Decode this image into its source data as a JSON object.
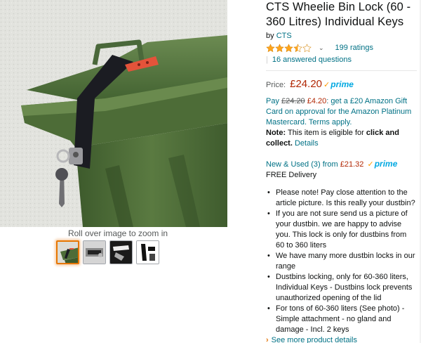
{
  "product": {
    "title": "CTS Wheelie Bin Lock (60 - 360 Litres) Individual Keys",
    "by_label": "by",
    "brand": "CTS",
    "rating": 3.5,
    "ratings_count": "199 ratings",
    "answered_questions": "16 answered questions",
    "qa_separator": "|"
  },
  "image": {
    "zoom_hint": "Roll over image to zoom in",
    "thumbnail_count": 4,
    "selected_thumbnail": 0
  },
  "price": {
    "label": "Price:",
    "value": "£24.20",
    "prime_label": "prime"
  },
  "promo": {
    "pay": "Pay",
    "old_price": "£24.20",
    "new_price": "£4.20",
    "text": ": get a £20 Amazon Gift Card on approval for the Amazon Platinum Mastercard. Terms apply."
  },
  "note": {
    "label": "Note:",
    "text_before": "This item is eligible for",
    "bold": "click and collect.",
    "details": "Details"
  },
  "used": {
    "link": "New & Used (3) from",
    "price": "£21.32",
    "prime": "prime",
    "delivery": "FREE Delivery"
  },
  "bullets": [
    "Please note! Pay close attention to the article picture. Is this really your dustbin?",
    "If you are not sure send us a picture of your dustbin. we are happy to advise you. This lock is only for dustbins from 60 to 360 liters",
    "We have many more dustbin locks in our range",
    "Dustbins locking, only for 60-360 liters, Individual Keys - Dustbins lock prevents unauthorized opening of the lid",
    "For tons of 60-360 liters (See photo) - Simple attachment - no gland and damage - Incl. 2 keys"
  ],
  "see_more": "See more product details",
  "colors": {
    "link": "#007185",
    "price": "#b12704",
    "prime": "#00a8e1",
    "star": "#ffa41c"
  }
}
